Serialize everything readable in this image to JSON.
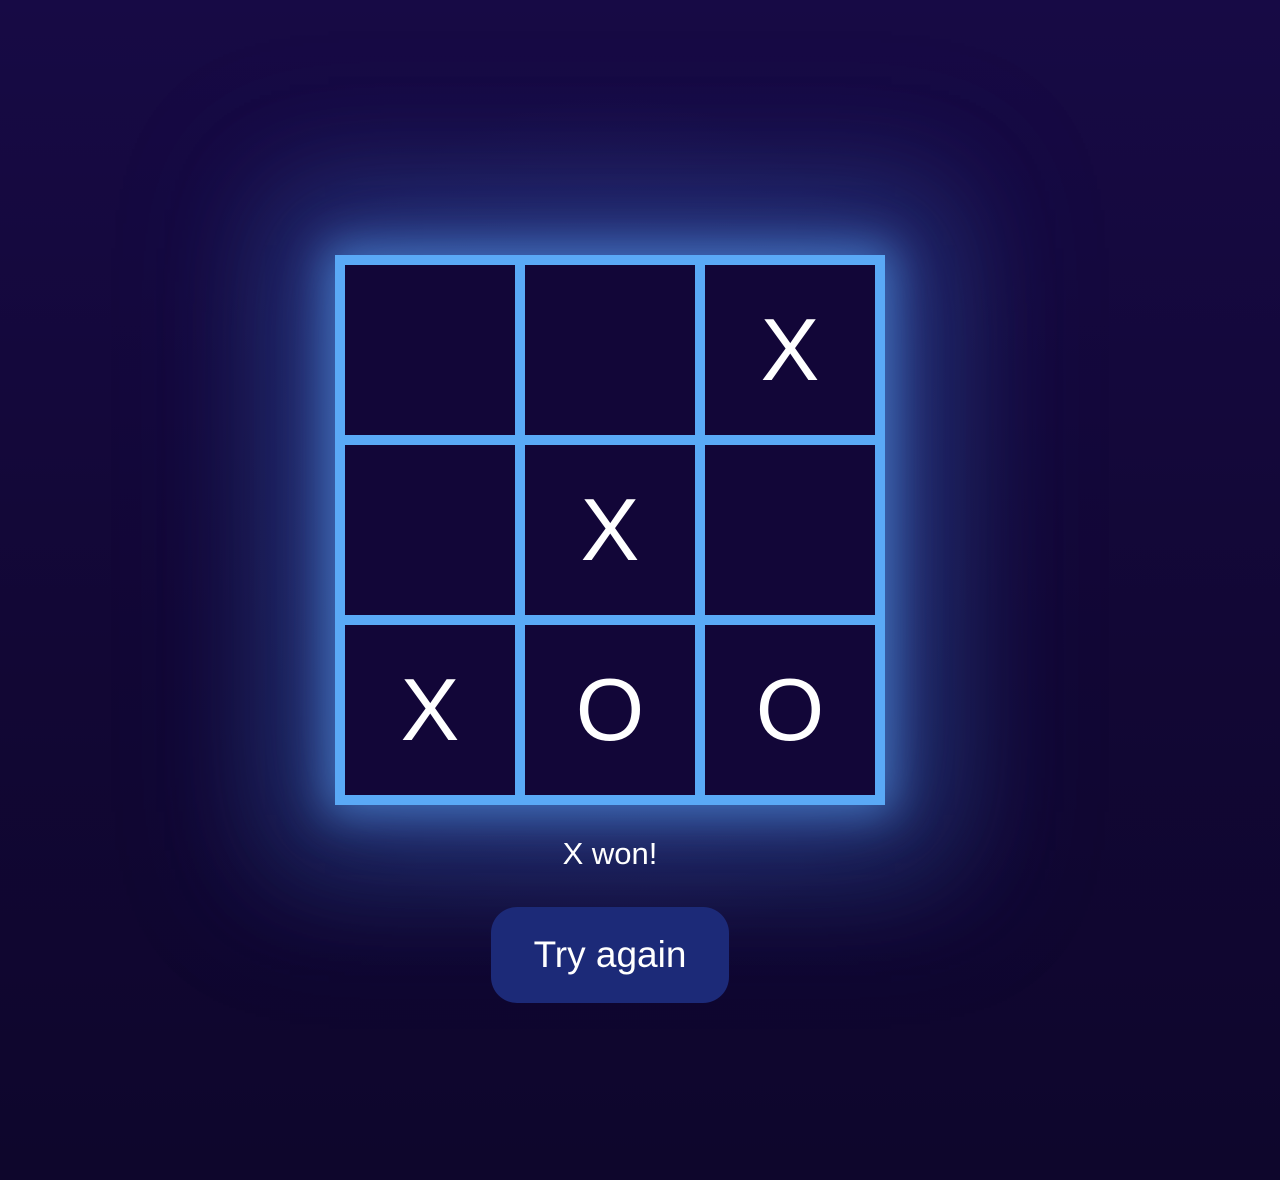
{
  "board": {
    "cells": [
      "",
      "",
      "X",
      "",
      "X",
      "",
      "X",
      "O",
      "O"
    ]
  },
  "status": "X won!",
  "actions": {
    "try_again_label": "Try again"
  },
  "colors": {
    "background": "#140838",
    "grid_lines": "#5aa9f6",
    "cell_background": "#120638",
    "button_background": "#1c2a78",
    "text": "#ffffff"
  }
}
